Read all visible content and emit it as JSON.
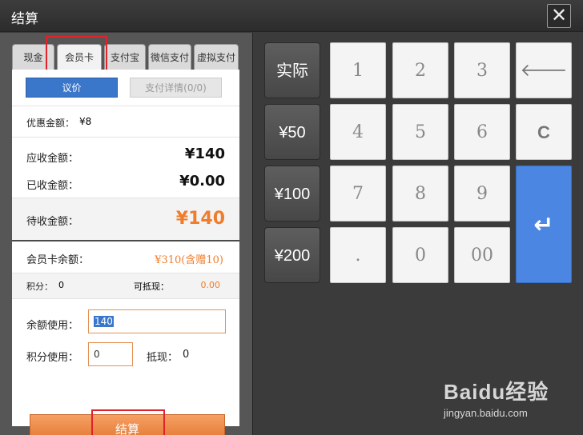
{
  "window": {
    "title": "结算",
    "close_glyph": "✕"
  },
  "tabs": [
    {
      "label": "现金"
    },
    {
      "label": "会员卡",
      "active": true
    },
    {
      "label": "支付宝"
    },
    {
      "label": "微信支付"
    },
    {
      "label": "虚拟支付"
    }
  ],
  "actions": {
    "bargain_label": "议价",
    "payment_detail_label": "支付详情(0/0)"
  },
  "summary": {
    "discount_label": "优惠金额：",
    "discount_value": "¥8",
    "receivable_label": "应收金额：",
    "receivable_value": "¥140",
    "received_label": "已收金额：",
    "received_value": "¥0.00",
    "pending_label": "待收金额：",
    "pending_value": "¥140"
  },
  "member": {
    "balance_label": "会员卡余额：",
    "balance_value": "¥310(含赠10)",
    "points_label": "积分：",
    "points_value": "0",
    "deductible_label": "可抵现：",
    "deductible_value": "0.00"
  },
  "inputs": {
    "balance_use_label": "余额使用：",
    "balance_use_value": "140",
    "points_use_label": "积分使用：",
    "points_use_value": "0",
    "offset_label": "抵现：",
    "offset_value": "0"
  },
  "checkout_label": "结算",
  "keypad": {
    "actual": "实际",
    "q50": "¥50",
    "q100": "¥100",
    "q200": "¥200",
    "k1": "1",
    "k2": "2",
    "k3": "3",
    "k4": "4",
    "k5": "5",
    "k6": "6",
    "k7": "7",
    "k8": "8",
    "k9": "9",
    "kdot": ".",
    "k0": "0",
    "k00": "00",
    "clear": "C",
    "backspace_glyph": "🡐",
    "enter_glyph": "↵"
  },
  "watermark": {
    "top": "Baidu经验",
    "bottom": "jingyan.baidu.com"
  },
  "colors": {
    "accent_blue": "#3a76c9",
    "accent_orange": "#f07d2c",
    "highlight_red": "#e0222a"
  }
}
